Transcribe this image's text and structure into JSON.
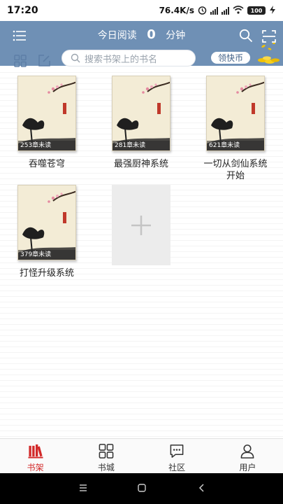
{
  "status_bar": {
    "time": "17:20",
    "net_speed": "76.4K/s",
    "battery": "100"
  },
  "header": {
    "read_today_label": "今日阅读",
    "read_today_minutes": "0",
    "minutes_unit": "分钟"
  },
  "toolbar": {
    "search_placeholder": "搜索书架上的书名",
    "coin_button": "领快币"
  },
  "books": [
    {
      "title": "吞噬苍穹",
      "unread": "253章未读"
    },
    {
      "title": "最强厨神系统",
      "unread": "281章未读"
    },
    {
      "title": "一切从剑仙系统开始",
      "unread": "621章未读"
    },
    {
      "title": "打怪升级系统",
      "unread": "379章未读"
    }
  ],
  "bottom_nav": [
    {
      "label": "书架",
      "icon": "bookshelf-icon",
      "active": true
    },
    {
      "label": "书城",
      "icon": "bookstore-grid-icon",
      "active": false
    },
    {
      "label": "社区",
      "icon": "community-chat-icon",
      "active": false
    },
    {
      "label": "用户",
      "icon": "user-icon",
      "active": false
    }
  ],
  "colors": {
    "header_bg": "#6f90b5",
    "active_tab": "#d22a2a"
  }
}
